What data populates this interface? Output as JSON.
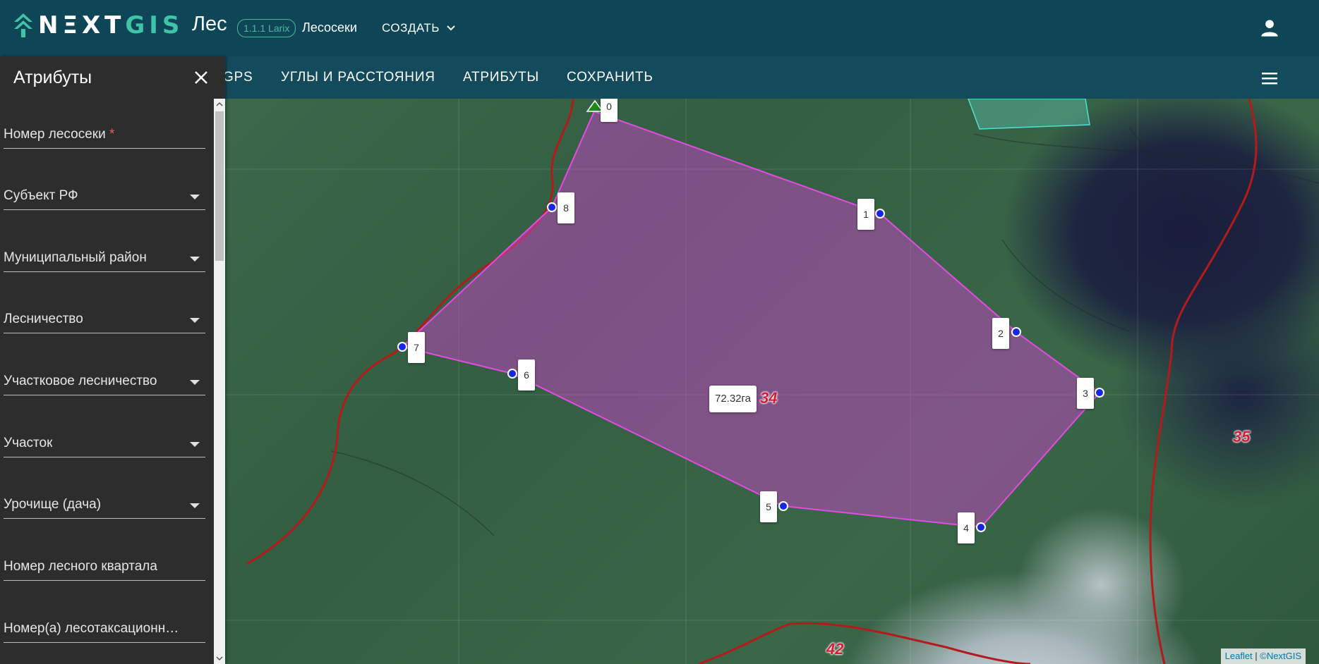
{
  "header": {
    "brand_main": "NΞXT",
    "brand_accent": "GIS",
    "app_name": "Лес",
    "version": "1.1.1 Larix",
    "section": "Лесосеки",
    "create_label": "СОЗДАТЬ",
    "icons": [
      "nextgis-logo-icon",
      "chevron-down-icon",
      "user-icon"
    ]
  },
  "toolbar": {
    "items": [
      "GPS",
      "УГЛЫ И РАССТОЯНИЯ",
      "АТРИБУТЫ",
      "СОХРАНИТЬ"
    ],
    "menu_icon": "hamburger-menu-icon"
  },
  "panel": {
    "title": "Атрибуты",
    "close_icon": "close-icon",
    "fields": [
      {
        "label": "Номер лесосеки",
        "required": "*"
      },
      {
        "label": "Субъект РФ"
      },
      {
        "label": "Муниципальный район"
      },
      {
        "label": "Лесничество"
      },
      {
        "label": "Участковое лесничество"
      },
      {
        "label": "Участок"
      },
      {
        "label": "Урочище (дача)"
      },
      {
        "label": "Номер лесного квартала"
      },
      {
        "label": "Номер(а) лесотаксационн…"
      }
    ]
  },
  "map": {
    "area_label": "72.32га",
    "vertices": [
      "0",
      "1",
      "2",
      "3",
      "4",
      "5",
      "6",
      "7",
      "8"
    ],
    "quarter_numbers": [
      "34",
      "35",
      "42"
    ],
    "attribution": {
      "leaflet": "Leaflet",
      "separator": " | ",
      "nextgis": "©NextGIS"
    },
    "colors": {
      "polygon": "#c944c9",
      "vertex": "#1526e6",
      "boundary": "#b01a1a",
      "start_marker": "#1a8a1a"
    }
  }
}
